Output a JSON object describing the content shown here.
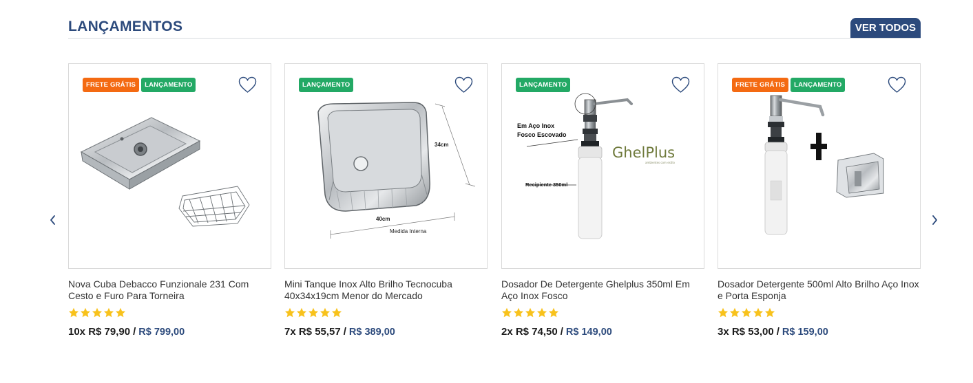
{
  "section": {
    "title": "LANÇAMENTOS",
    "view_all_label": "VER TODOS"
  },
  "colors": {
    "brand": "#2c4a7c",
    "badge_free_shipping": "#f46a12",
    "badge_launch": "#23a965",
    "star": "#f8c21c"
  },
  "icons": {
    "prev": "chevron-left-icon",
    "next": "chevron-right-icon",
    "favorite": "heart-icon",
    "rating": "star-icon"
  },
  "products": [
    {
      "badges": [
        "FRETE GRÁTIS",
        "LANÇAMENTO"
      ],
      "name": "Nova Cuba Debacco Funzionale 231 Com Cesto e Furo Para Torneira",
      "rating": 5,
      "installments": "10x R$ 79,90",
      "separator": "/",
      "total": "R$ 799,00"
    },
    {
      "badges": [
        "LANÇAMENTO"
      ],
      "name": "Mini Tanque Inox Alto Brilho Tecnocuba 40x34x19cm Menor do Mercado",
      "rating": 5,
      "installments": "7x R$ 55,57",
      "separator": "/",
      "total": "R$ 389,00",
      "image_text": {
        "depth": "34cm",
        "width": "40cm",
        "caption": "Medida Interna"
      }
    },
    {
      "badges": [
        "LANÇAMENTO"
      ],
      "name": "Dosador De Detergente Ghelplus 350ml Em Aço Inox Fosco",
      "rating": 5,
      "installments": "2x R$ 74,50",
      "separator": "/",
      "total": "R$ 149,00",
      "image_text": {
        "line1": "Em Aço Inox",
        "line2": "Fosco Escovado",
        "capacity": "Recipiente 350ml",
        "logo": "GhelPlus",
        "tagline": "ambientes com estilo"
      }
    },
    {
      "badges": [
        "FRETE GRÁTIS",
        "LANÇAMENTO"
      ],
      "name": "Dosador Detergente 500ml Alto Brilho Aço Inox e Porta Esponja",
      "rating": 5,
      "installments": "3x R$ 53,00",
      "separator": "/",
      "total": "R$ 159,00"
    }
  ]
}
